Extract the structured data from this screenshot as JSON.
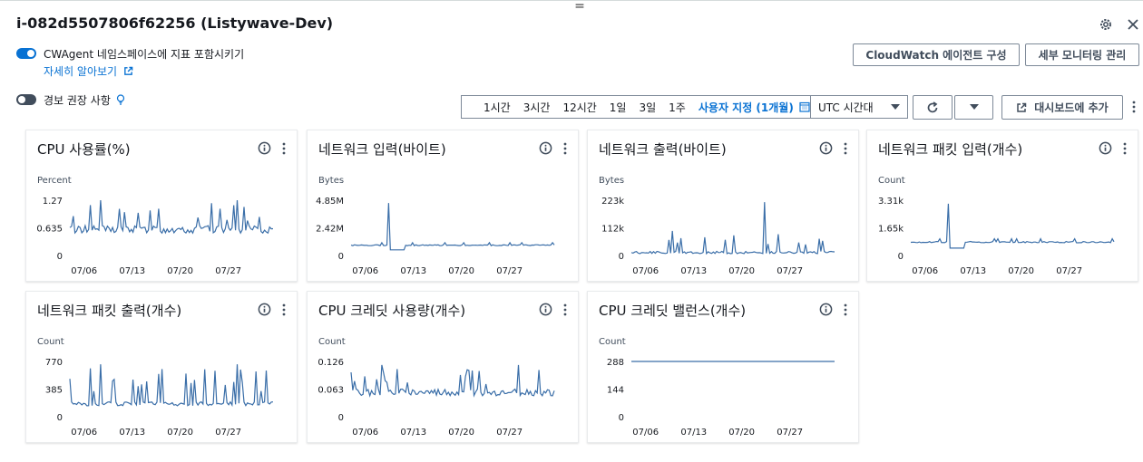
{
  "header": {
    "title": "i-082d5507806f62256 (Listywave-Dev)",
    "drag_glyph": "="
  },
  "options": {
    "cwagent_label": "CWAgent 네임스페이스에 지표 포함시키기",
    "cwagent_enabled": true,
    "learn_more": "자세히 알아보기",
    "alarm_reco_label": "경보 권장 사항",
    "alarm_reco_enabled": false
  },
  "buttons": {
    "cloudwatch_agent": "CloudWatch 에이전트 구성",
    "detailed_monitoring": "세부 모니터링 관리",
    "add_to_dashboard": "대시보드에 추가"
  },
  "time_range": {
    "items": [
      "1시간",
      "3시간",
      "12시간",
      "1일",
      "3일",
      "1주"
    ],
    "custom": "사용자 지정 (1개월)",
    "timezone": "UTC 시간대"
  },
  "colors": {
    "accent": "#0972d3",
    "series": "#3a6ea8"
  },
  "widgets": [
    {
      "title": "CPU 사용률(%)",
      "unit": "Percent"
    },
    {
      "title": "네트워크 입력(바이트)",
      "unit": "Bytes"
    },
    {
      "title": "네트워크 출력(바이트)",
      "unit": "Bytes"
    },
    {
      "title": "네트워크 패킷 입력(개수)",
      "unit": "Count"
    },
    {
      "title": "네트워크 패킷 출력(개수)",
      "unit": "Count"
    },
    {
      "title": "CPU 크레딧 사용량(개수)",
      "unit": "Count"
    },
    {
      "title": "CPU 크레딧 밸런스(개수)",
      "unit": "Count"
    }
  ],
  "chart_data": [
    {
      "type": "line",
      "ylabel": "Percent",
      "yticks": [
        "0",
        "0.635",
        "1.27"
      ],
      "ylim": [
        0,
        1.27
      ],
      "xticks": [
        "07/06",
        "07/13",
        "07/20",
        "07/27"
      ],
      "profile": "spiky",
      "base": 0.6,
      "peak": 1.27
    },
    {
      "type": "line",
      "ylabel": "Bytes",
      "yticks": [
        "0",
        "2.42M",
        "4.85M"
      ],
      "ylim": [
        0,
        4.85
      ],
      "xticks": [
        "07/06",
        "07/13",
        "07/20",
        "07/27"
      ],
      "profile": "single-spike",
      "base": 0.9,
      "peak": 4.6
    },
    {
      "type": "line",
      "ylabel": "Bytes",
      "yticks": [
        "0",
        "112k",
        "223k"
      ],
      "ylim": [
        0,
        223
      ],
      "xticks": [
        "07/06",
        "07/13",
        "07/20",
        "07/27"
      ],
      "profile": "low-spiky",
      "base": 12,
      "peak": 215
    },
    {
      "type": "line",
      "ylabel": "Count",
      "yticks": [
        "0",
        "1.65k",
        "3.31k"
      ],
      "ylim": [
        0,
        3.31
      ],
      "xticks": [
        "07/06",
        "07/13",
        "07/20",
        "07/27"
      ],
      "profile": "single-spike",
      "base": 0.8,
      "peak": 3.1
    },
    {
      "type": "line",
      "ylabel": "Count",
      "yticks": [
        "0",
        "385",
        "770"
      ],
      "ylim": [
        0,
        770
      ],
      "xticks": [
        "07/06",
        "07/13",
        "07/20",
        "07/27"
      ],
      "profile": "spiky",
      "base": 180,
      "peak": 730
    },
    {
      "type": "line",
      "ylabel": "Count",
      "yticks": [
        "0",
        "0.063",
        "0.126"
      ],
      "ylim": [
        0,
        0.126
      ],
      "xticks": [
        "07/06",
        "07/13",
        "07/20",
        "07/27"
      ],
      "profile": "spiky",
      "base": 0.055,
      "peak": 0.118
    },
    {
      "type": "line",
      "ylabel": "Count",
      "yticks": [
        "0",
        "144",
        "288"
      ],
      "ylim": [
        0,
        288
      ],
      "xticks": [
        "07/06",
        "07/13",
        "07/20",
        "07/27"
      ],
      "profile": "flat",
      "base": 288,
      "peak": 288
    }
  ]
}
